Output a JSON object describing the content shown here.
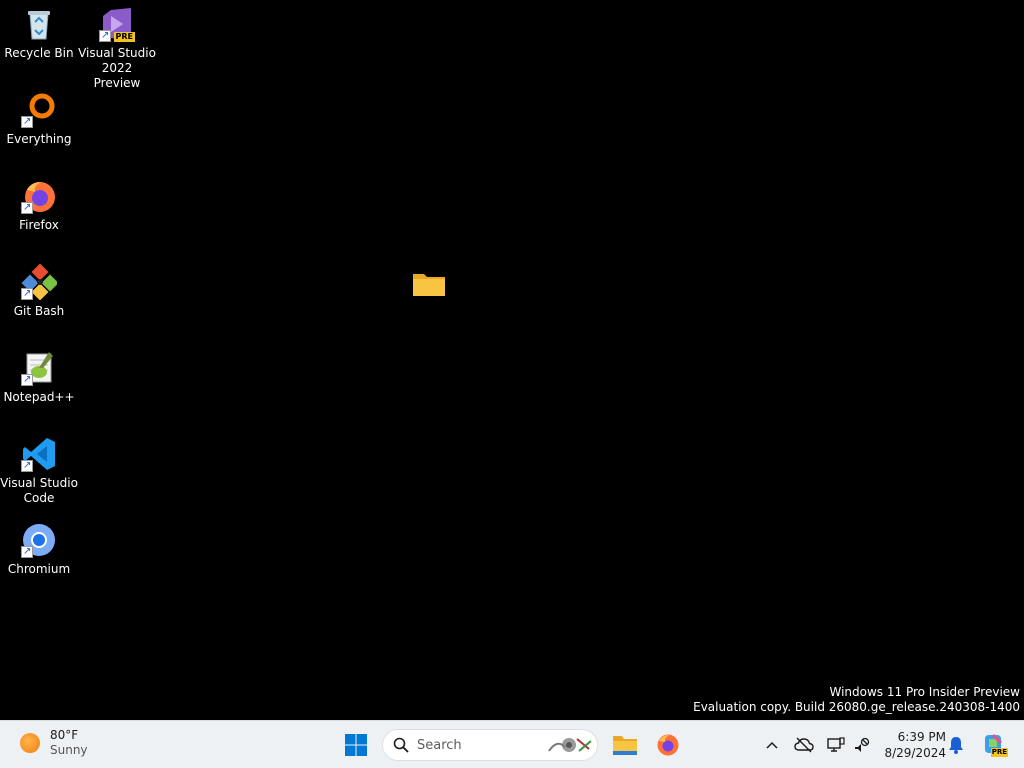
{
  "desktop": {
    "icons": [
      {
        "label": "Recycle Bin"
      },
      {
        "label": "Visual Studio 2022 Preview",
        "badge": "PRE"
      },
      {
        "label": "Everything"
      },
      {
        "label": "Firefox"
      },
      {
        "label": "Git Bash"
      },
      {
        "label": "Notepad++"
      },
      {
        "label": "Visual Studio Code"
      },
      {
        "label": "Chromium"
      },
      {
        "label": ""
      }
    ]
  },
  "watermark": {
    "line1": "Windows 11 Pro Insider Preview",
    "line2": "Evaluation copy. Build 26080.ge_release.240308-1400"
  },
  "taskbar": {
    "weather": {
      "temp": "80°F",
      "condition": "Sunny"
    },
    "search": {
      "placeholder": "Search"
    },
    "clock": {
      "time": "6:39 PM",
      "date": "8/29/2024"
    },
    "copilot_badge": "PRE"
  },
  "colors": {
    "desktop_bg": "#000000",
    "taskbar_bg": "#eef1f4",
    "windows_blue": "#0078d4",
    "folder_yellow": "#f8c542"
  }
}
